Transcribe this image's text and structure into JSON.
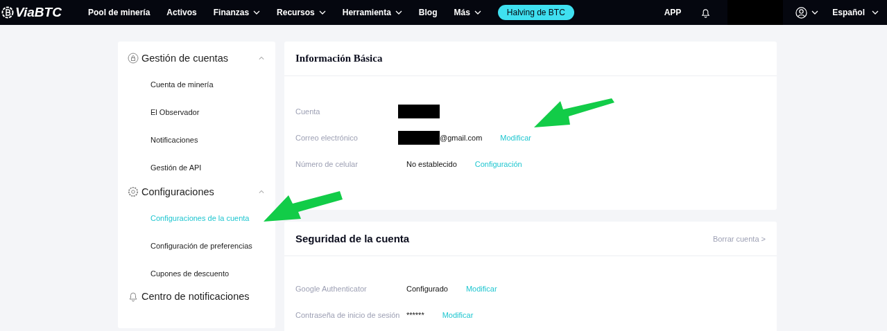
{
  "navbar": {
    "logo": "ViaBTC",
    "items": [
      {
        "label": "Pool de minería",
        "dropdown": false
      },
      {
        "label": "Activos",
        "dropdown": false
      },
      {
        "label": "Finanzas",
        "dropdown": true
      },
      {
        "label": "Recursos",
        "dropdown": true
      },
      {
        "label": "Herramienta",
        "dropdown": true
      },
      {
        "label": "Blog",
        "dropdown": false
      },
      {
        "label": "Más",
        "dropdown": true
      }
    ],
    "promo_button": "Halving de BTC",
    "app_link": "APP",
    "language": "Español"
  },
  "sidebar": {
    "groups": [
      {
        "title": "Gestión de cuentas",
        "collapsible": true,
        "items": [
          {
            "label": "Cuenta de minería",
            "selected": false
          },
          {
            "label": "El Observador",
            "selected": false
          },
          {
            "label": "Notificaciones",
            "selected": false
          },
          {
            "label": "Gestión de API",
            "selected": false
          }
        ]
      },
      {
        "title": "Configuraciones",
        "collapsible": true,
        "items": [
          {
            "label": "Configuraciones de la cuenta",
            "selected": true
          },
          {
            "label": "Configuración de preferencias",
            "selected": false
          },
          {
            "label": "Cupones de descuento",
            "selected": false
          }
        ]
      },
      {
        "title": "Centro de notificaciones",
        "collapsible": false
      }
    ]
  },
  "basic_info": {
    "title": "Información Básica",
    "rows": [
      {
        "label": "Cuenta",
        "redacted": true
      },
      {
        "label": "Correo electrónico",
        "redacted": true,
        "value": "@gmail.com",
        "action": "Modificar"
      },
      {
        "label": "Número de celular",
        "redacted": false,
        "value": "No establecido",
        "action": "Configuración"
      }
    ]
  },
  "account_security": {
    "title": "Seguridad de la cuenta",
    "delete_link": "Borrar cuenta >",
    "rows": [
      {
        "label": "Google Authenticator",
        "redacted": false,
        "value": "Configurado",
        "action": "Modificar"
      },
      {
        "label": "Contraseña de inicio de sesión",
        "redacted": false,
        "value": "******",
        "action": "Modificar"
      }
    ]
  }
}
